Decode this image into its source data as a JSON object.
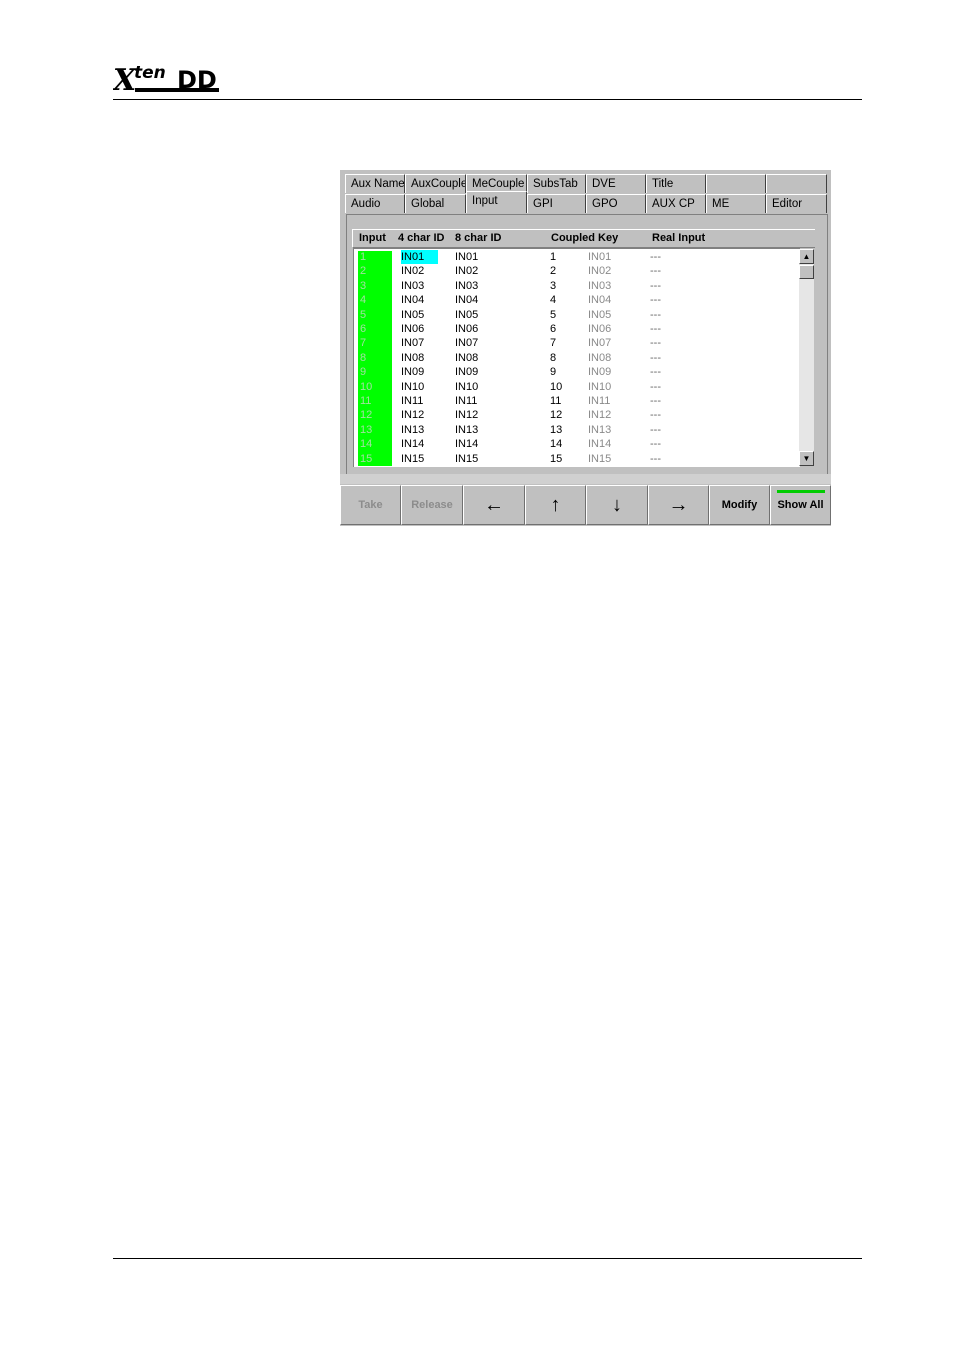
{
  "tabs_row1": [
    "Aux Name",
    "AuxCouple",
    "MeCouple",
    "SubsTab",
    "DVE",
    "Title",
    "",
    ""
  ],
  "tabs_row2": [
    "Audio",
    "Global",
    "Input",
    "GPI",
    "GPO",
    "AUX CP",
    "ME",
    "Editor"
  ],
  "active_tab": "Input",
  "columns": [
    "Input",
    "4 char ID",
    "8 char ID",
    "Coupled Key",
    "Real Input"
  ],
  "rows": [
    {
      "num": "1",
      "id4": "IN01",
      "id8": "IN01",
      "ck": "1",
      "ckid": "IN01",
      "real": "---"
    },
    {
      "num": "2",
      "id4": "IN02",
      "id8": "IN02",
      "ck": "2",
      "ckid": "IN02",
      "real": "---"
    },
    {
      "num": "3",
      "id4": "IN03",
      "id8": "IN03",
      "ck": "3",
      "ckid": "IN03",
      "real": "---"
    },
    {
      "num": "4",
      "id4": "IN04",
      "id8": "IN04",
      "ck": "4",
      "ckid": "IN04",
      "real": "---"
    },
    {
      "num": "5",
      "id4": "IN05",
      "id8": "IN05",
      "ck": "5",
      "ckid": "IN05",
      "real": "---"
    },
    {
      "num": "6",
      "id4": "IN06",
      "id8": "IN06",
      "ck": "6",
      "ckid": "IN06",
      "real": "---"
    },
    {
      "num": "7",
      "id4": "IN07",
      "id8": "IN07",
      "ck": "7",
      "ckid": "IN07",
      "real": "---"
    },
    {
      "num": "8",
      "id4": "IN08",
      "id8": "IN08",
      "ck": "8",
      "ckid": "IN08",
      "real": "---"
    },
    {
      "num": "9",
      "id4": "IN09",
      "id8": "IN09",
      "ck": "9",
      "ckid": "IN09",
      "real": "---"
    },
    {
      "num": "10",
      "id4": "IN10",
      "id8": "IN10",
      "ck": "10",
      "ckid": "IN10",
      "real": "---"
    },
    {
      "num": "11",
      "id4": "IN11",
      "id8": "IN11",
      "ck": "11",
      "ckid": "IN11",
      "real": "---"
    },
    {
      "num": "12",
      "id4": "IN12",
      "id8": "IN12",
      "ck": "12",
      "ckid": "IN12",
      "real": "---"
    },
    {
      "num": "13",
      "id4": "IN13",
      "id8": "IN13",
      "ck": "13",
      "ckid": "IN13",
      "real": "---"
    },
    {
      "num": "14",
      "id4": "IN14",
      "id8": "IN14",
      "ck": "14",
      "ckid": "IN14",
      "real": "---"
    },
    {
      "num": "15",
      "id4": "IN15",
      "id8": "IN15",
      "ck": "15",
      "ckid": "IN15",
      "real": "---"
    }
  ],
  "selected_row": "1",
  "buttons": {
    "take": "Take",
    "release": "Release",
    "left": "←",
    "up": "↑",
    "down": "↓",
    "right": "→",
    "modify": "Modify",
    "show_all": "Show All"
  },
  "colors": {
    "input_highlight": "#00ff00",
    "selection": "#00ffff",
    "panel": "#c0c0c0"
  },
  "icons": {
    "scroll_up": "triangle-up-icon",
    "scroll_down": "triangle-down-icon",
    "logo": "xten-dd-logo"
  }
}
